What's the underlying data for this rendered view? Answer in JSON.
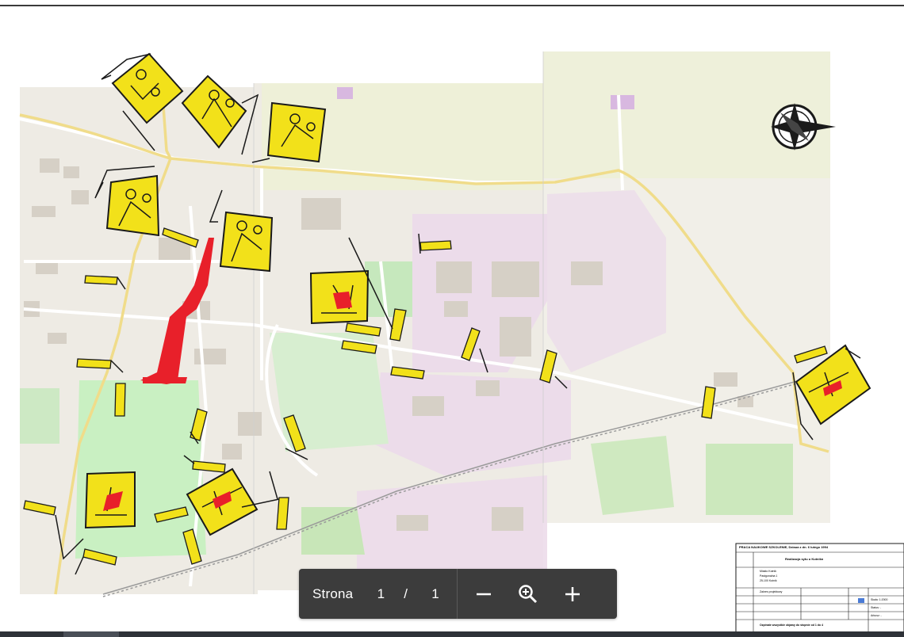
{
  "viewer": {
    "page_label": "Strona",
    "current_page": "1",
    "separator": "/",
    "total_pages": "1"
  },
  "icons": {
    "zoom_out": "minus-icon",
    "zoom_fit": "magnifier-plus-icon",
    "zoom_in": "plus-icon",
    "compass": "north-arrow-icon"
  },
  "colors": {
    "toolbar_bg": "#3c3c3c",
    "sign_yellow": "#f2e11a",
    "route_red": "#e8202a",
    "map_land": "#eeebe4",
    "park_green": "#c9f0c2",
    "industrial_pink": "#ecdcea",
    "road_yellow": "#f5e8a5"
  },
  "title_block": {
    "heading": "PRACA NAUKOWE SZKOLENIE, Dziaua z dn. 6 lutego 1994",
    "project": "Realizacja sytu u Kutnikn",
    "investor": "Miasto Kutnik",
    "address_line1": "Pastgonalna 1",
    "address_line2": "25-100 Kutnik",
    "phase": "Zakres projektowy",
    "scale_label": "Skala: 1:2000",
    "status_label": "Status: -",
    "sheet_label": "Arkusz: -",
    "drawing_title": "Ozpinate wszystkie objawy do stopnie od 1 do 4"
  }
}
